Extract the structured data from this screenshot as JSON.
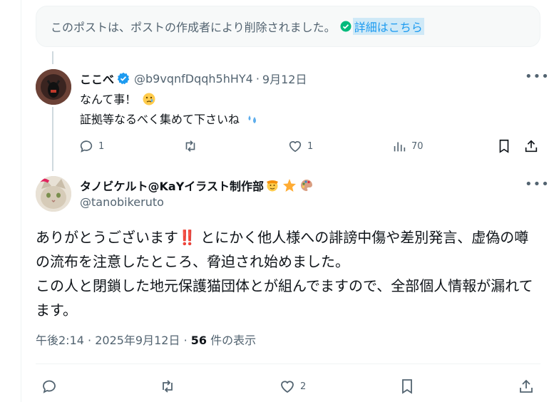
{
  "deleted_notice": {
    "text": "このポストは、ポストの作成者により削除されました。",
    "link": "詳細はこちら"
  },
  "reply": {
    "name": "ここべ",
    "handle": "@b9vqnfDqqh5hHY4",
    "separator": "·",
    "date": "9月12日",
    "line1": "なんて事！",
    "line2": "証拠等なるべく集めて下さいね",
    "counts": {
      "reply": "1",
      "repost": "",
      "like": "1",
      "views": "70"
    }
  },
  "main_post": {
    "name": "タノビケルト@KaYイラスト制作部",
    "handle": "@tanobikeruto",
    "text_part1": "ありがとうございます",
    "bangs": "‼️",
    "text_part2": " とにかく他人様への誹謗中傷や差別発言、虚偽の噂の流布を注意したところ、脅迫され始めました。",
    "text_part3": "この人と閉鎖した地元保護猫団体とが組んでますので、全部個人情報が漏れてます。",
    "time": "午後2:14",
    "date": "2025年9月12日",
    "view_count": "56",
    "view_label": "件の表示",
    "counts": {
      "like": "2"
    }
  },
  "colors": {
    "accent": "#1d9bf0",
    "muted": "#536471",
    "text": "#0f1419"
  }
}
